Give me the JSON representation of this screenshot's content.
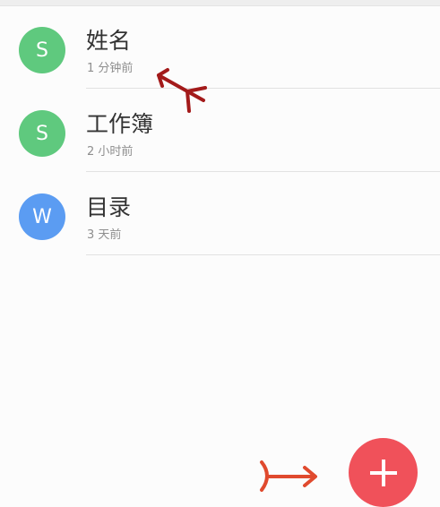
{
  "files": [
    {
      "initial": "S",
      "name": "姓名",
      "time": "1 分钟前",
      "color": "#5fc97e"
    },
    {
      "initial": "S",
      "name": "工作簿",
      "time": "2 小时前",
      "color": "#5fc97e"
    },
    {
      "initial": "W",
      "name": "目录",
      "time": "3 天前",
      "color": "#5b9cf2"
    }
  ],
  "fab": {
    "icon": "plus-icon",
    "color": "#f0515a"
  },
  "annotations": {
    "color_dark": "#a31a1a",
    "color_light": "#e04a2e"
  }
}
